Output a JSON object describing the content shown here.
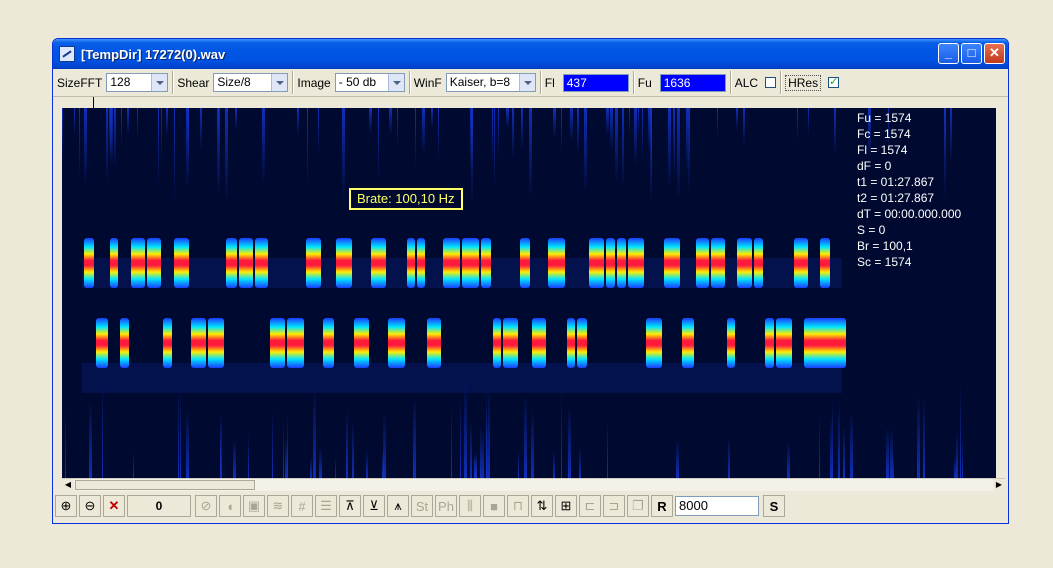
{
  "window": {
    "title": "[TempDir] 17272(0).wav",
    "controls": [
      "_",
      "□",
      "✕"
    ]
  },
  "toolbar": {
    "sizefft": {
      "label": "SizeFFT",
      "value": "128"
    },
    "shear": {
      "label": "Shear",
      "value": "Size/8"
    },
    "image": {
      "label": "Image",
      "value": "- 50 db"
    },
    "winf": {
      "label": "WinF",
      "value": "Kaiser, b=8"
    },
    "fl": {
      "label": "Fl",
      "value": "437"
    },
    "fu": {
      "label": "Fu",
      "value": "1636"
    },
    "alc": {
      "label": "ALC",
      "checked": false
    },
    "hres": {
      "label": "HRes",
      "checked": true
    }
  },
  "spectrogram": {
    "brate_label": "Brate: 100,10 Hz",
    "readout": [
      "Fu = 1574",
      "Fc = 1574",
      "Fl = 1574",
      "dF = 0",
      "t1 = 01:27.867",
      "t2 = 01:27.867",
      "dT = 00:00.000.000",
      "S = 0",
      "Br = 100,1",
      "Sc = 1574"
    ],
    "colors": {
      "background": "#000a30",
      "tone": "#ff0033",
      "text": "#ffffff",
      "label": "#ffff66"
    }
  },
  "bottom": {
    "count": "0",
    "rate": "8000",
    "r_label": "R",
    "s_label": "S",
    "st_label": "St",
    "ph_label": "Ph",
    "icons": [
      "zoom-in-icon",
      "zoom-out-icon",
      "delete-icon",
      "no-icon",
      "speaker-icon",
      "frame-icon",
      "filter-icon",
      "grid-icon",
      "list-icon",
      "marker-up-icon",
      "marker-down-icon",
      "marker-both-icon",
      "stop-icon",
      "wave-icon",
      "freq-icon",
      "qr-icon",
      "bracket-icon",
      "bracket2-icon",
      "copy-icon"
    ]
  }
}
